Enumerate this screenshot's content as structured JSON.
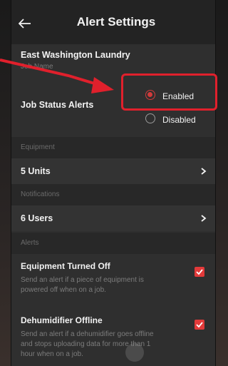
{
  "header": {
    "title": "Alert Settings"
  },
  "job": {
    "name": "East Washington Laundry",
    "label": "Job Name"
  },
  "status": {
    "label": "Job Status Alerts",
    "options": [
      "Enabled",
      "Disabled"
    ],
    "selected": "Enabled"
  },
  "equipment": {
    "section": "Equipment",
    "value": "5 Units"
  },
  "notifications": {
    "section": "Notifications",
    "value": "6 Users"
  },
  "alerts": {
    "section": "Alerts",
    "items": [
      {
        "title": "Equipment Turned Off",
        "desc": "Send an alert if a piece of equipment is powered off when on a job.",
        "checked": true
      },
      {
        "title": "Dehumidifier Offline",
        "desc": "Send an alert if a dehumidifier goes offline and stops uploading data for more than 1 hour when on a job.",
        "checked": true
      }
    ]
  },
  "colors": {
    "accent": "#e23a3a",
    "annotation": "#e0202c",
    "panel": "#2f2f2f"
  }
}
